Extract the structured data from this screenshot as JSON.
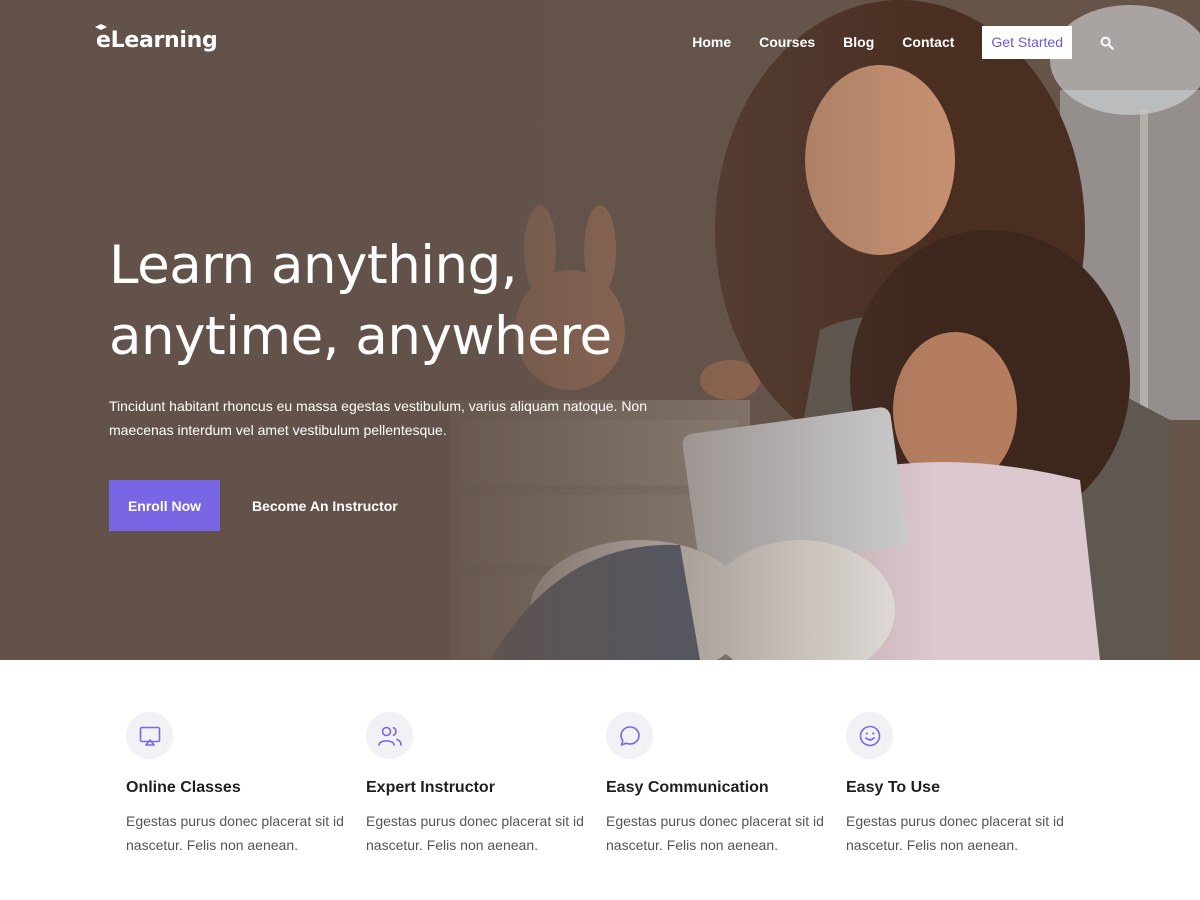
{
  "brand": {
    "logo_text": "eLearning"
  },
  "nav": {
    "items": [
      "Home",
      "Courses",
      "Blog",
      "Contact"
    ],
    "cta_label": "Get Started",
    "search_icon": "search-icon"
  },
  "hero": {
    "title_line1": "Learn anything,",
    "title_line2": "anytime, anywhere",
    "description": "Tincidunt habitant rhoncus eu massa egestas vestibulum, varius aliquam natoque. Non maecenas interdum vel amet vestibulum pellentesque.",
    "primary_label": "Enroll Now",
    "secondary_label": "Become An Instructor"
  },
  "features": [
    {
      "icon": "monitor-cast-icon",
      "title": "Online Classes",
      "text": "Egestas purus donec placerat sit id nascetur. Felis non aenean."
    },
    {
      "icon": "users-icon",
      "title": "Expert Instructor",
      "text": "Egestas purus donec placerat sit id nascetur. Felis non aenean."
    },
    {
      "icon": "chat-bubble-icon",
      "title": "Easy Communication",
      "text": "Egestas purus donec placerat sit id nascetur. Felis non aenean."
    },
    {
      "icon": "smile-icon",
      "title": "Easy To Use",
      "text": "Egestas purus donec placerat sit id nascetur. Felis non aenean."
    }
  ],
  "colors": {
    "accent": "#7866e4",
    "hero_overlay": "#62524a",
    "icon_bg": "#f2f1f6",
    "white": "#ffffff"
  }
}
